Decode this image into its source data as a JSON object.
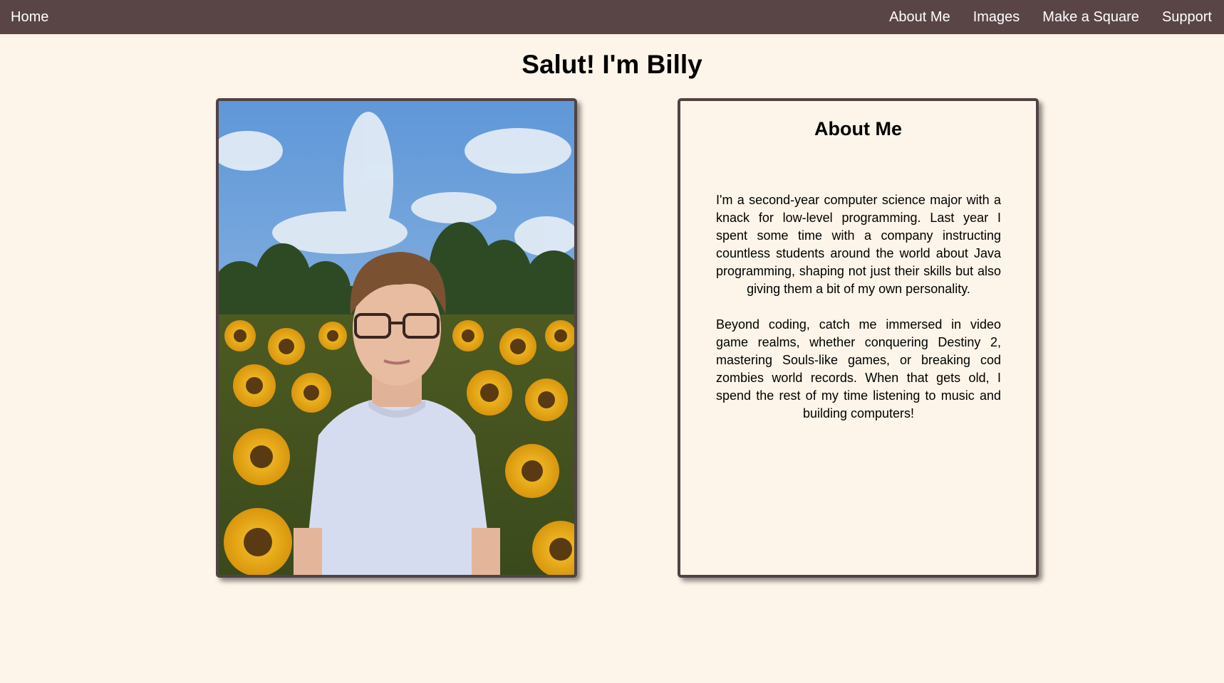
{
  "nav": {
    "home_label": "Home",
    "links": [
      {
        "label": "About Me"
      },
      {
        "label": "Images"
      },
      {
        "label": "Make a Square"
      },
      {
        "label": "Support"
      }
    ]
  },
  "page_title": "Salut! I'm Billy",
  "about": {
    "heading": "About Me",
    "paragraphs": [
      "I'm a second-year computer science major with a knack for low-level programming. Last year I spent some time with a company instructing countless students around the world about Java programming, shaping not just their skills but also giving them a bit of my own personality.",
      "Beyond coding, catch me immersed in video game realms, whether conquering Destiny 2, mastering Souls-like games, or breaking cod zombies world records. When that gets old, I spend the rest of my time listening to music and building computers!"
    ]
  },
  "colors": {
    "background": "#fdf5e9",
    "navbar": "#5a4546",
    "card_border": "#524244"
  }
}
